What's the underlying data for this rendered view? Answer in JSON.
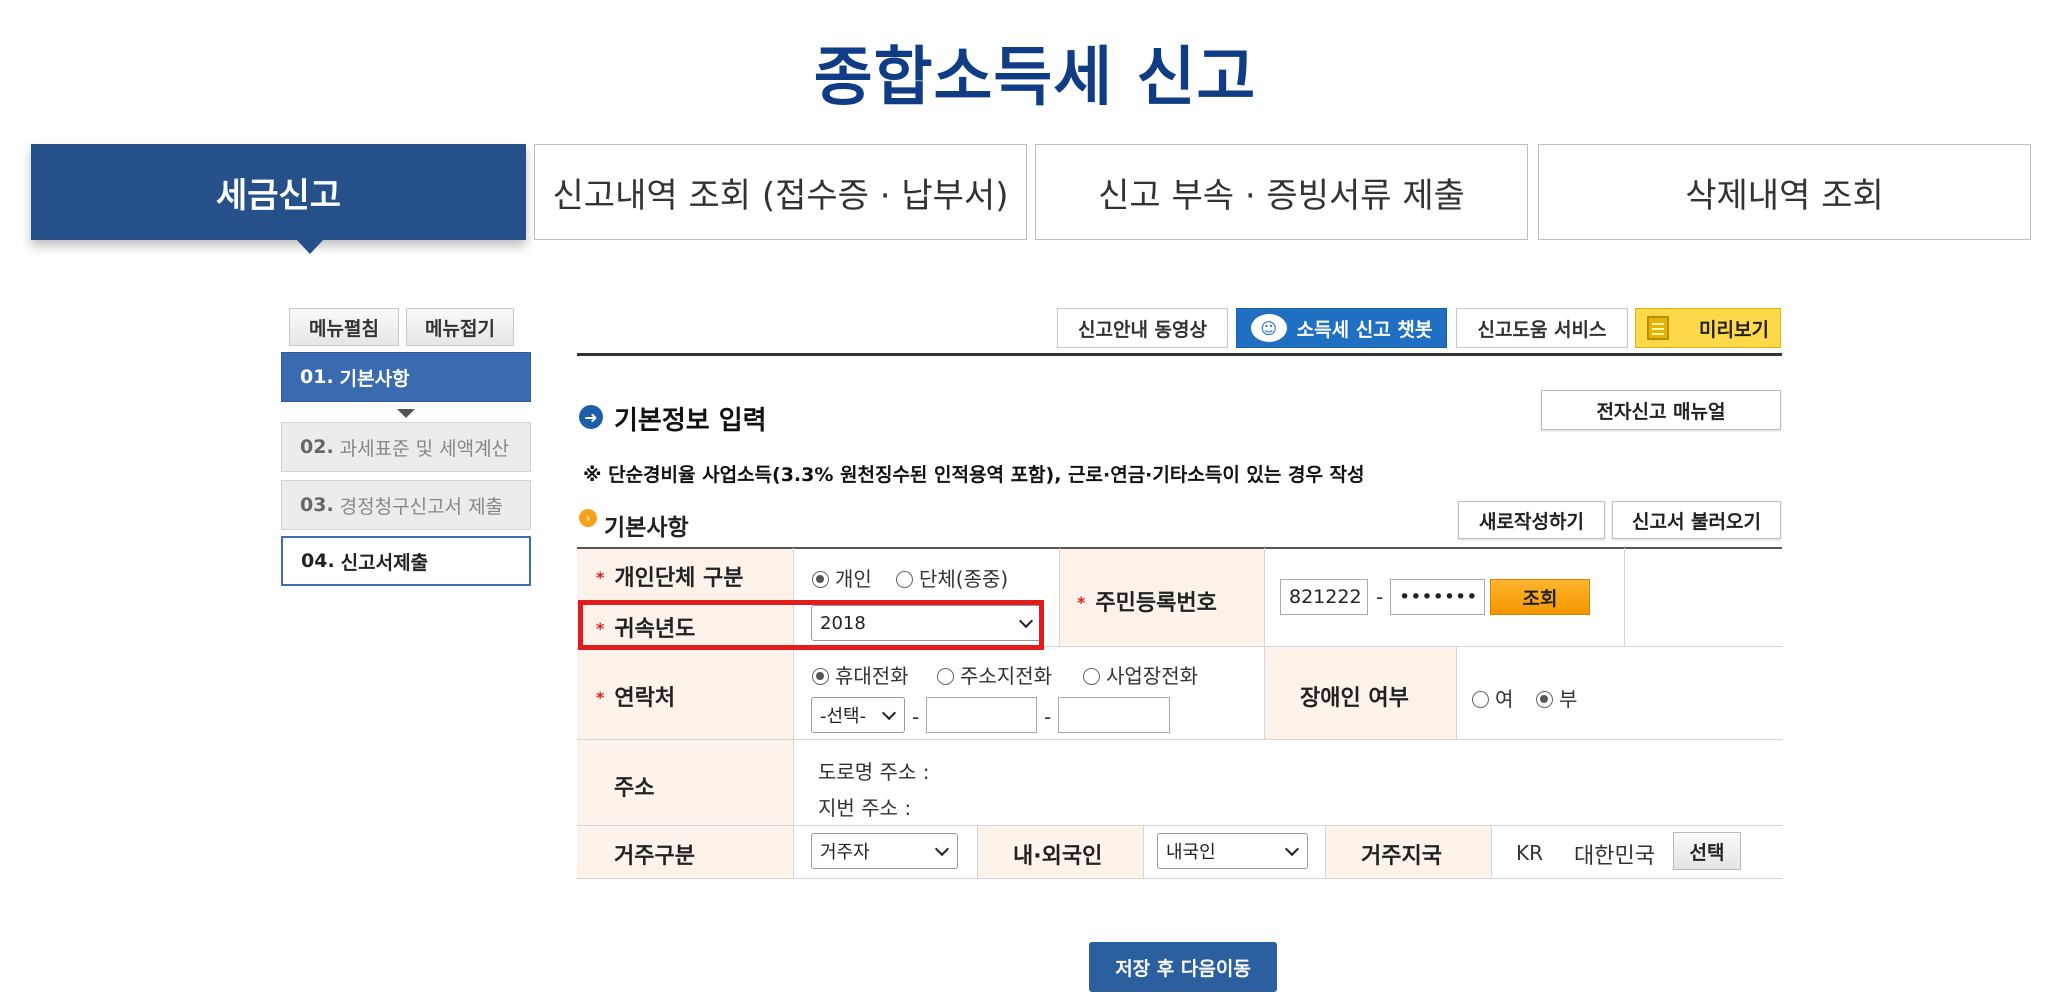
{
  "page_title": "종합소득세 신고",
  "top_tabs": [
    {
      "label": "세금신고"
    },
    {
      "label": "신고내역 조회 (접수증 · 납부서)"
    },
    {
      "label": "신고 부속 · 증빙서류 제출"
    },
    {
      "label": "삭제내역 조회"
    }
  ],
  "side_menu": {
    "expand_label": "메뉴펼침",
    "collapse_label": "메뉴접기",
    "steps": [
      {
        "num": "01.",
        "label": "기본사항"
      },
      {
        "num": "02.",
        "label": "과세표준 및 세액계산"
      },
      {
        "num": "03.",
        "label": "경정청구신고서 제출"
      },
      {
        "num": "04.",
        "label": "신고서제출"
      }
    ]
  },
  "toolbar": {
    "video_label": "신고안내 동영상",
    "chatbot_label": "소득세 신고 챗봇",
    "help_label": "신고도움 서비스",
    "preview_label": "미리보기"
  },
  "section": {
    "title": "기본정보 입력",
    "manual_label": "전자신고 매뉴얼",
    "notice": "※ 단순경비율 사업소득(3.3% 원천징수된 인적용역 포함), 근로·연금·기타소득이 있는 경우 작성"
  },
  "basic": {
    "title": "기본사항",
    "new_label": "새로작성하기",
    "load_label": "신고서 불러오기"
  },
  "form": {
    "type_label": "개인단체 구분",
    "type_options": [
      "개인",
      "단체(종중)"
    ],
    "year_label": "귀속년도",
    "year_value": "2018",
    "rrn_label": "주민등록번호",
    "rrn_front": "821222",
    "rrn_back": "•••••••",
    "lookup_label": "조회",
    "contact_label": "연락처",
    "phone_options": [
      "휴대전화",
      "주소지전화",
      "사업장전화"
    ],
    "phone_select": "-선택-",
    "disabled_label": "장애인 여부",
    "disabled_options": [
      "여",
      "부"
    ],
    "address_label": "주소",
    "road_address": "도로명 주소 :",
    "lot_address": "지번 주소 :",
    "residence_label": "거주구분",
    "residence_value": "거주자",
    "nationality_label": "내·외국인",
    "nationality_value": "내국인",
    "country_label": "거주지국",
    "country_code": "KR",
    "country_name": "대한민국",
    "select_label": "선택"
  },
  "save_label": "저장 후 다음이동",
  "colors": {
    "brand": "#0f3c85",
    "tab_active": "#26508a",
    "highlight": "#e31b1b",
    "lookup": "#f39600"
  }
}
